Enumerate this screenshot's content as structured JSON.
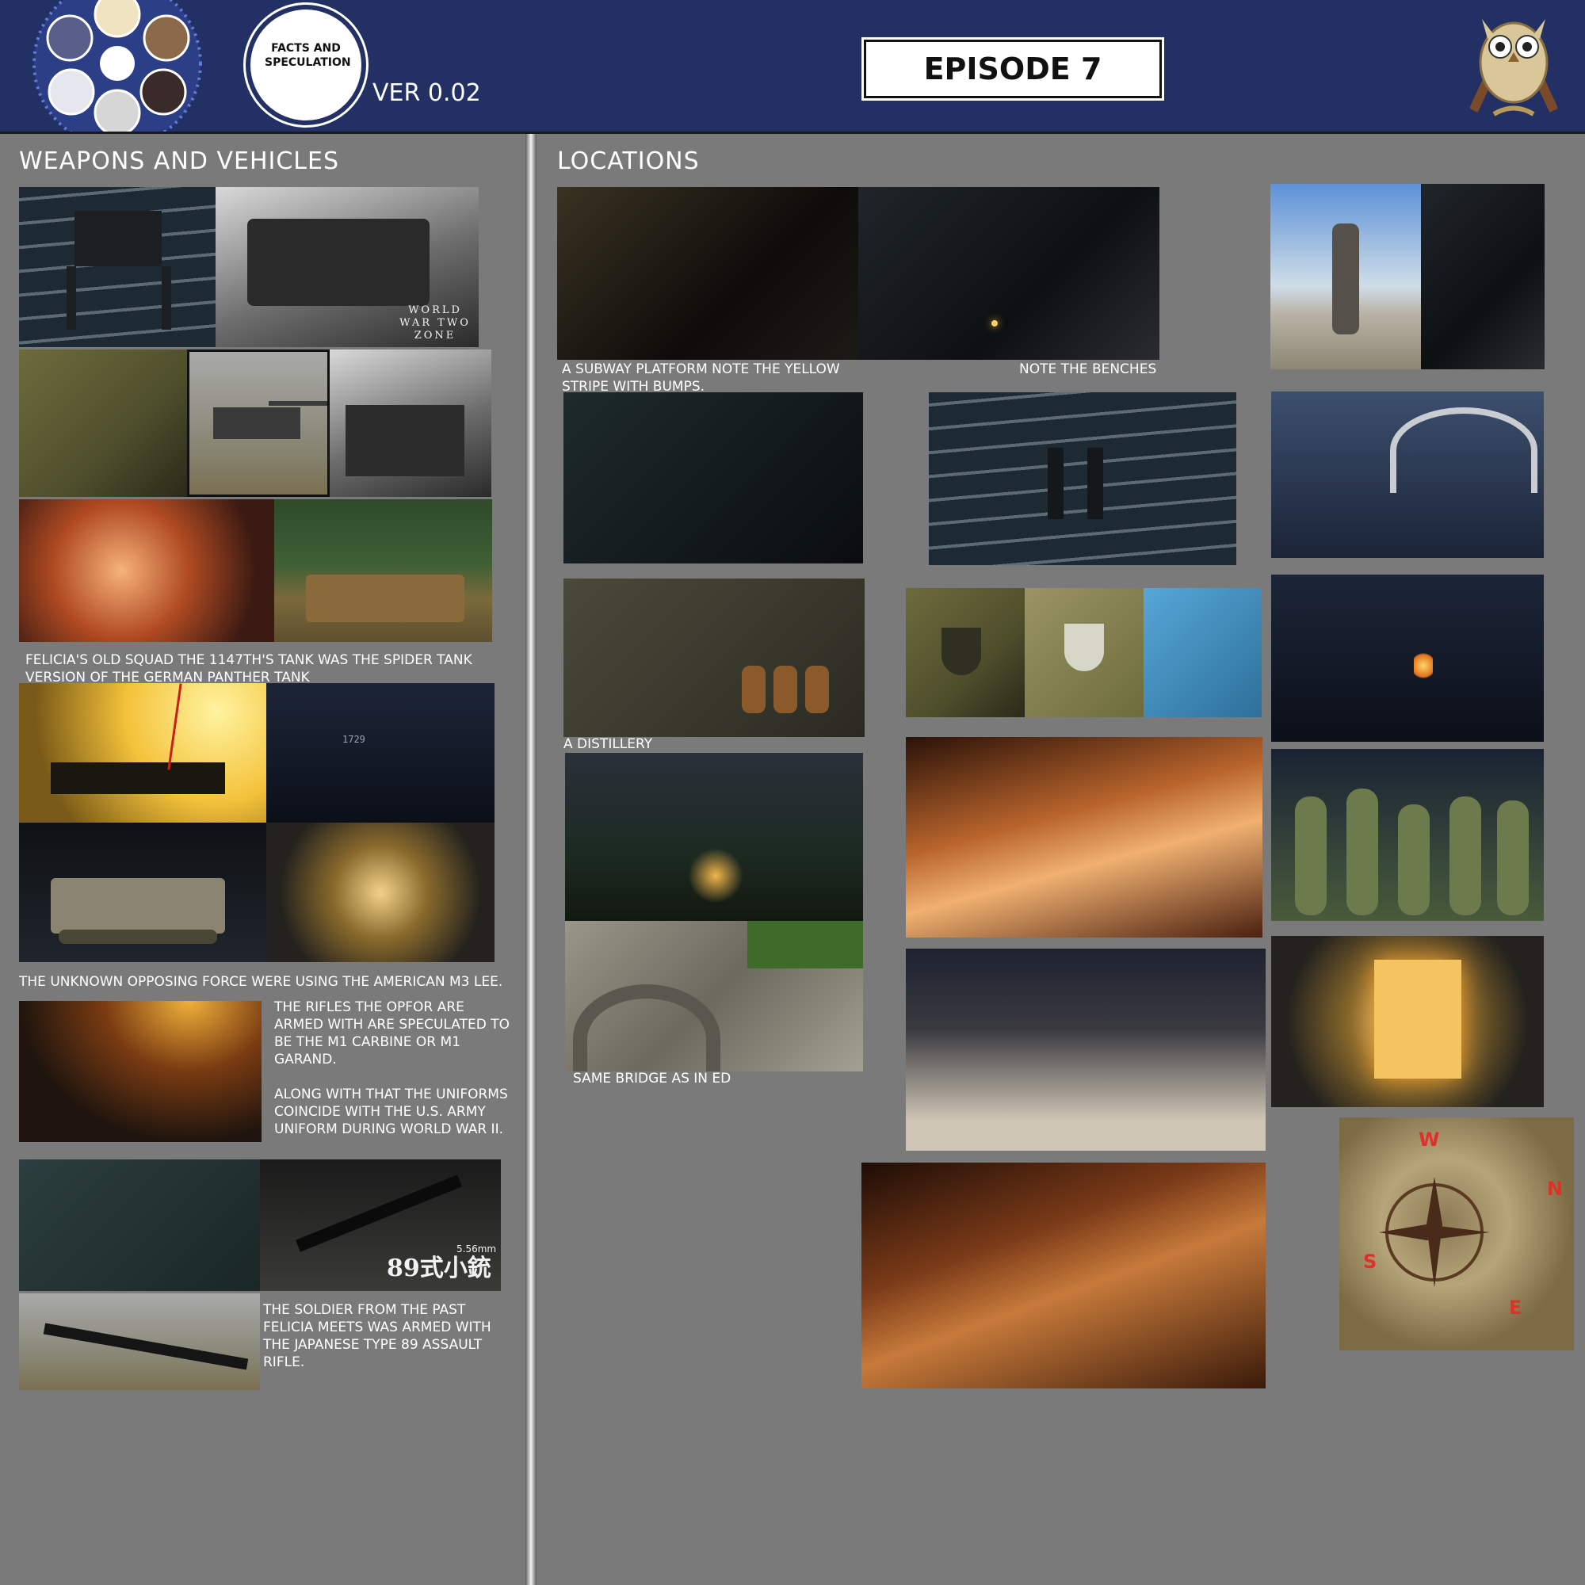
{
  "header": {
    "logo_badge": "FACTS AND SPECULATION",
    "version": "VER 0.02",
    "episode": "EPISODE 7"
  },
  "weapons": {
    "title": "WEAPONS AND VEHICLES",
    "watermark": "WORLD WAR TWO ZONE",
    "caption_panther": "FELICIA'S OLD SQUAD THE 1147TH'S TANK WAS THE SPIDER TANK VERSION OF THE GERMAN PANTHER TANK",
    "caption_m3": "THE UNKNOWN OPPOSING FORCE WERE USING THE AMERICAN M3 LEE.",
    "caption_rifles_1": "THE RIFLES THE OPFOR ARE ARMED WITH ARE SPECULATED TO BE THE M1 CARBINE OR M1 GARAND.",
    "caption_rifles_2": "ALONG WITH THAT THE UNIFORMS COINCIDE WITH THE U.S. ARMY UNIFORM DURING WORLD WAR II.",
    "caption_type89": "THE SOLDIER FROM THE PAST FELICIA MEETS WAS ARMED WITH THE JAPANESE TYPE 89 ASSAULT RIFLE.",
    "tank_number": "1729",
    "rifle_label": "89式小銃",
    "rifle_caliber": "5.56mm"
  },
  "locations": {
    "title": "LOCATIONS",
    "caption_subway": "A SUBWAY PLATFORM NOTE THE YELLOW STRIPE WITH BUMPS.",
    "caption_benches": "NOTE THE BENCHES",
    "caption_distillery": "A DISTILLERY",
    "caption_bridge": "SAME BRIDGE AS IN ED",
    "compass": {
      "w": "W",
      "n": "N",
      "s": "S",
      "e": "E"
    }
  },
  "colors": {
    "header_bg": "#223063",
    "panel_bg": "#7a7a7a",
    "compass_text": "#e0302a"
  }
}
